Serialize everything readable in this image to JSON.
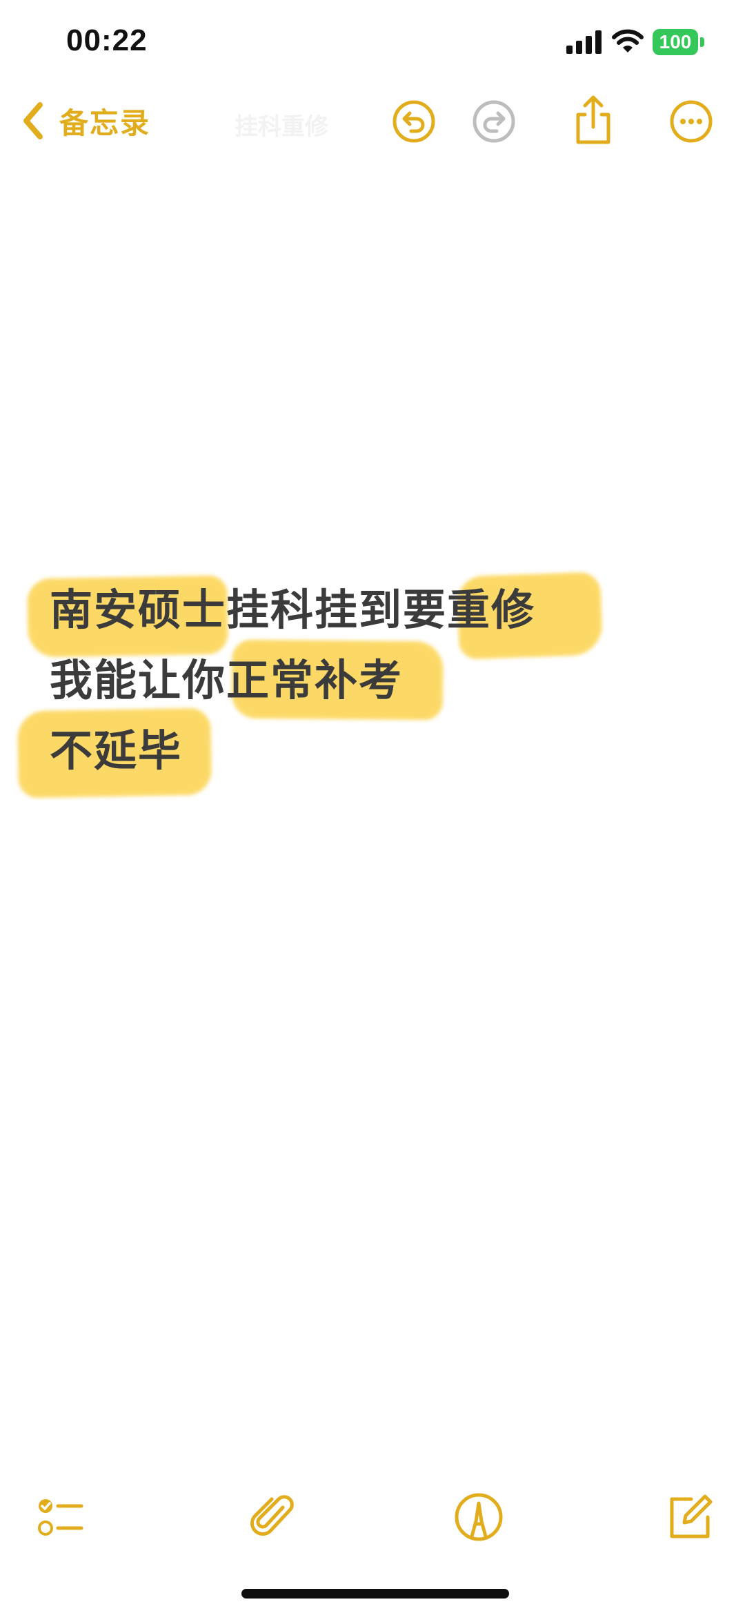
{
  "status_bar": {
    "time": "00:22",
    "battery": "100",
    "icons": [
      "signal-icon",
      "wifi-icon",
      "battery-icon"
    ],
    "battery_color": "#34c759"
  },
  "nav": {
    "back_label": "备忘录",
    "ghost_title": "挂科重修",
    "icons": [
      "chevron-left-icon",
      "undo-icon",
      "redo-icon",
      "share-icon",
      "more-icon"
    ]
  },
  "note": {
    "lines": [
      "南安硕士挂科挂到要重修",
      "我能让你正常补考",
      "不延毕"
    ],
    "highlighted_phrases": [
      "南安硕士",
      "重修",
      "正常补考",
      "不延毕"
    ]
  },
  "toolbar": {
    "icons": [
      "checklist-icon",
      "paperclip-icon",
      "markup-icon",
      "compose-icon"
    ]
  },
  "colors": {
    "accent": "#e2ad1c",
    "highlight": "#fcd34d",
    "text": "#3b3b3b",
    "disabled": "#bdbdbd"
  }
}
